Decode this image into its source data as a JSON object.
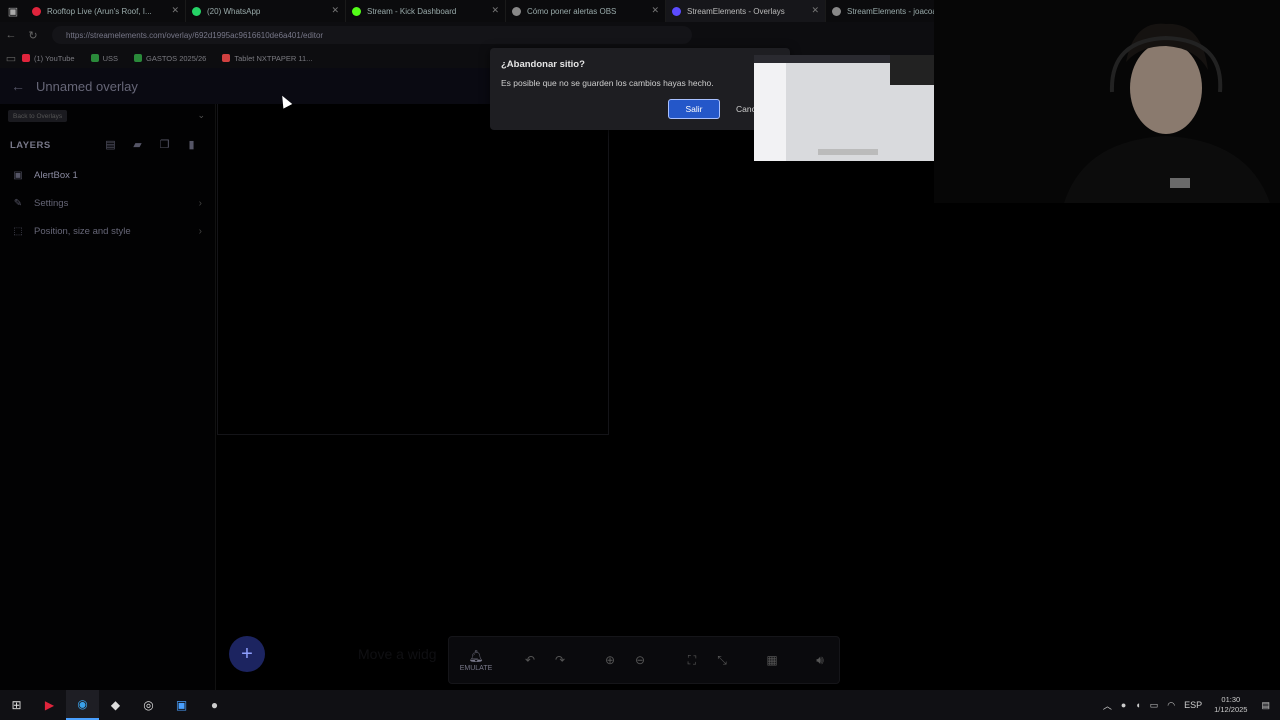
{
  "browser": {
    "tabs": [
      {
        "title": "Rooftop Live (Arun's Roof, I...",
        "color": "#e0243c"
      },
      {
        "title": "(20) WhatsApp",
        "color": "#25d366"
      },
      {
        "title": "Stream - Kick Dashboard",
        "color": "#53fc18"
      },
      {
        "title": "Cómo poner alertas OBS",
        "color": "#888888"
      },
      {
        "title": "StreamElements - Overlays",
        "color": "#5b4bff"
      },
      {
        "title": "StreamElements - joacoa...",
        "color": "#888888"
      }
    ],
    "url": "https://streamelements.com/overlay/692d1995ac9616610de6a401/editor",
    "bookmarks": [
      {
        "label": "(1) YouTube",
        "color": "#e0243c"
      },
      {
        "label": "USS",
        "color": "#2a8a3a"
      },
      {
        "label": "GASTOS 2025/26",
        "color": "#2a8a3a"
      },
      {
        "label": "Tablet NXTPAPER 11...",
        "color": "#d04040"
      }
    ]
  },
  "editor": {
    "overlay_title": "Unnamed overlay",
    "back_to_overlays": "Back to Overlays",
    "layers_heading": "LAYERS",
    "layer_item": "AlertBox 1",
    "settings_label": "Settings",
    "position_label": "Position, size and style",
    "move_hint": "Move a widg",
    "emulate_label": "EMULATE"
  },
  "dialog": {
    "title": "¿Abandonar sitio?",
    "message": "Es posible que no se guarden los cambios hayas hecho.",
    "confirm": "Salir",
    "cancel": "Cancelar"
  },
  "system": {
    "language": "ESP",
    "time": "01:30",
    "date": "1/12/2025"
  }
}
